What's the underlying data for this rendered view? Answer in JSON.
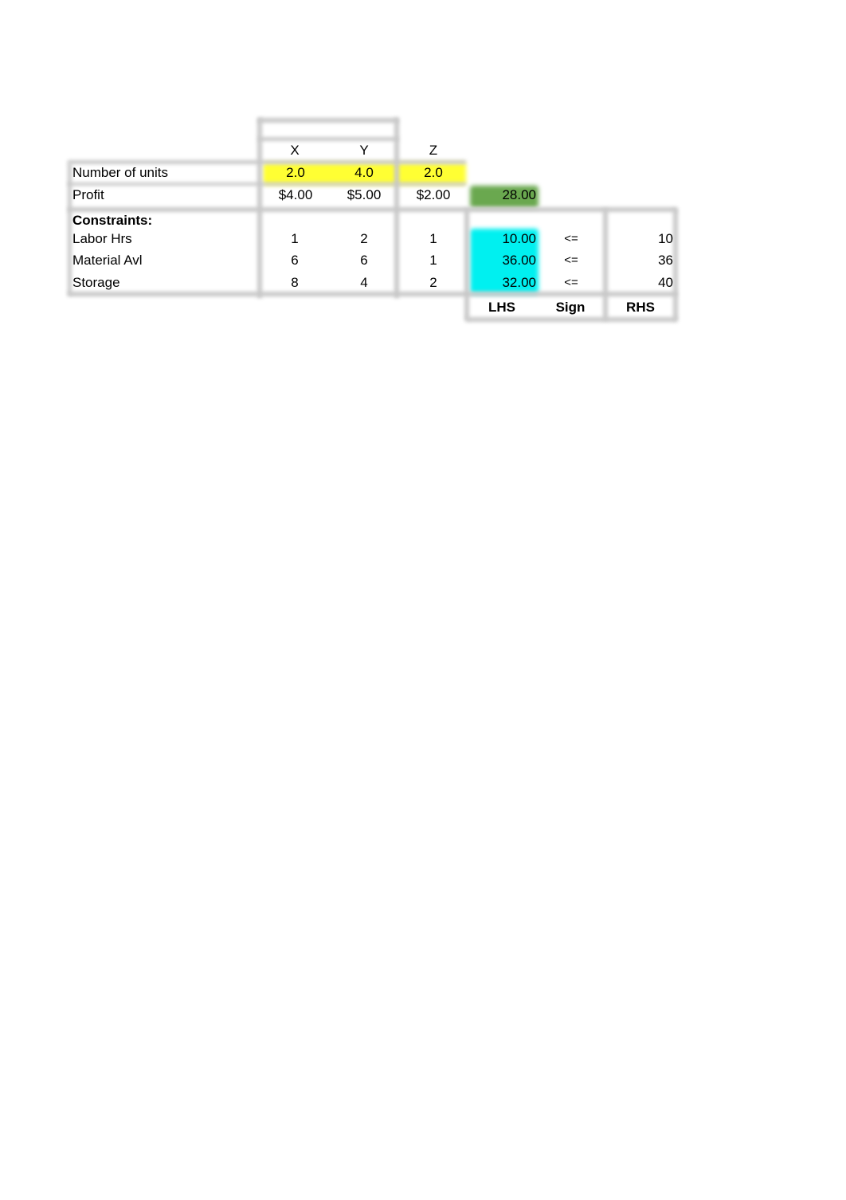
{
  "colors": {
    "decision_cells": "#ffff33",
    "objective_cell": "#6aa84f",
    "lhs_cells": "#00f0f0",
    "gridlines": "#c8c8c8"
  },
  "columns": [
    "X",
    "Y",
    "Z"
  ],
  "rows": {
    "units": {
      "label": "Number of units",
      "values": [
        "2.0",
        "4.0",
        "2.0"
      ]
    },
    "profit": {
      "label": "Profit",
      "values": [
        "$4.00",
        "$5.00",
        "$2.00"
      ],
      "total": "28.00"
    }
  },
  "constraints_heading": "Constraints:",
  "constraints": [
    {
      "label": "Labor Hrs",
      "coef": [
        "1",
        "2",
        "1"
      ],
      "lhs": "10.00",
      "sign": "<=",
      "rhs": "10"
    },
    {
      "label": "Material Avl",
      "coef": [
        "6",
        "6",
        "1"
      ],
      "lhs": "36.00",
      "sign": "<=",
      "rhs": "36"
    },
    {
      "label": "Storage",
      "coef": [
        "8",
        "4",
        "2"
      ],
      "lhs": "32.00",
      "sign": "<=",
      "rhs": "40"
    }
  ],
  "footer": {
    "lhs": "LHS",
    "sign": "Sign",
    "rhs": "RHS"
  }
}
